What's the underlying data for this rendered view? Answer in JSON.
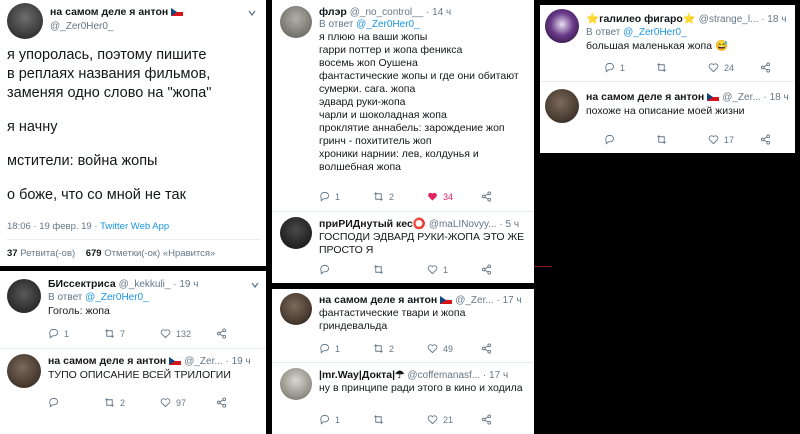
{
  "main_tweet": {
    "name": "на самом деле я антон",
    "handle": "@_Zer0Her0_",
    "lines": [
      "я упоролась, поэтому пишите",
      "в реплаях названия фильмов,",
      "заменяя одно слово на \"жопа\""
    ],
    "line2": "я начну",
    "line3": "мстители: война жопы",
    "line4": "о боже, что со мной не так",
    "time": "18:06 · 19 февр. 19 ·",
    "client": "Twitter Web App",
    "retweets_count": "37",
    "retweets_label": "Ретвита(-ов)",
    "likes_count": "679",
    "likes_label": "Отметки(-ок) «Нравится»"
  },
  "reply_bis": {
    "name": "БИссектриса",
    "handle": "@_kekkuli_ · 19 ч",
    "reply_prefix": "В ответ",
    "reply_to": "@_Zer0Her0_",
    "text": "Гоголь: жопа",
    "replies": "1",
    "retweets": "7",
    "likes": "132"
  },
  "reply_anton1": {
    "name": "на самом деле я антон",
    "handle": "@_Zer... · 19 ч",
    "text": "ТУПО ОПИСАНИЕ ВСЕЙ ТРИЛОГИИ",
    "retweets": "2",
    "likes": "97"
  },
  "reply_flar": {
    "name": "флэр",
    "handle": "@_no_control__ · 14 ч",
    "reply_prefix": "В ответ",
    "reply_to": "@_Zer0Her0_",
    "lines": [
      "я плюю на ваши жопы",
      "гарри поттер и жопа феникса",
      "восемь жоп Оушена",
      "фантастические жопы и где они обитают",
      "сумерки. сага. жопа",
      "эдвард руки-жопа",
      "чарли и шоколадная жопа",
      "проклятие аннабель: зарождение жоп",
      "гринч - похититель жоп",
      "хроники нарнии: лев, колдунья и",
      "волшебная жопа"
    ],
    "replies": "1",
    "retweets": "2",
    "likes": "34"
  },
  "reply_pri": {
    "name": "приРИДнутый кес⭕",
    "handle": "@maLINovyy... · 5 ч",
    "lines": [
      "ГОСПОДИ ЭДВАРД РУКИ-ЖОПА ЭТО ЖЕ",
      "ПРОСТО Я"
    ],
    "likes": "1"
  },
  "reply_anton2": {
    "name": "на самом деле я антон",
    "handle": "@_Zer... · 17 ч",
    "lines": [
      "фантастические твари и жопа",
      "гриндевальда"
    ],
    "replies": "1",
    "retweets": "2",
    "likes": "49"
  },
  "reply_mrway": {
    "name": "|mr.Way|Докта|☂",
    "handle": "@coffemanasf... · 17 ч",
    "text": "ну в принципе ради этого в кино и ходила",
    "replies": "1",
    "likes": "21"
  },
  "reply_galileo": {
    "name": "⭐галилео фигаро⭐",
    "handle": "@strange_l... · 18 ч",
    "reply_prefix": "В ответ",
    "reply_to": "@_Zer0Her0_",
    "text": "большая маленькая жопа 😅",
    "replies": "1",
    "likes": "24"
  },
  "reply_anton3": {
    "name": "на самом деле я антон",
    "handle": "@_Zer... · 18 ч",
    "text": "похоже на описание моей жизни",
    "likes": "17"
  },
  "colors": {
    "link": "#1b95e0",
    "secondary": "#657786",
    "like_red": "#e0245e"
  }
}
